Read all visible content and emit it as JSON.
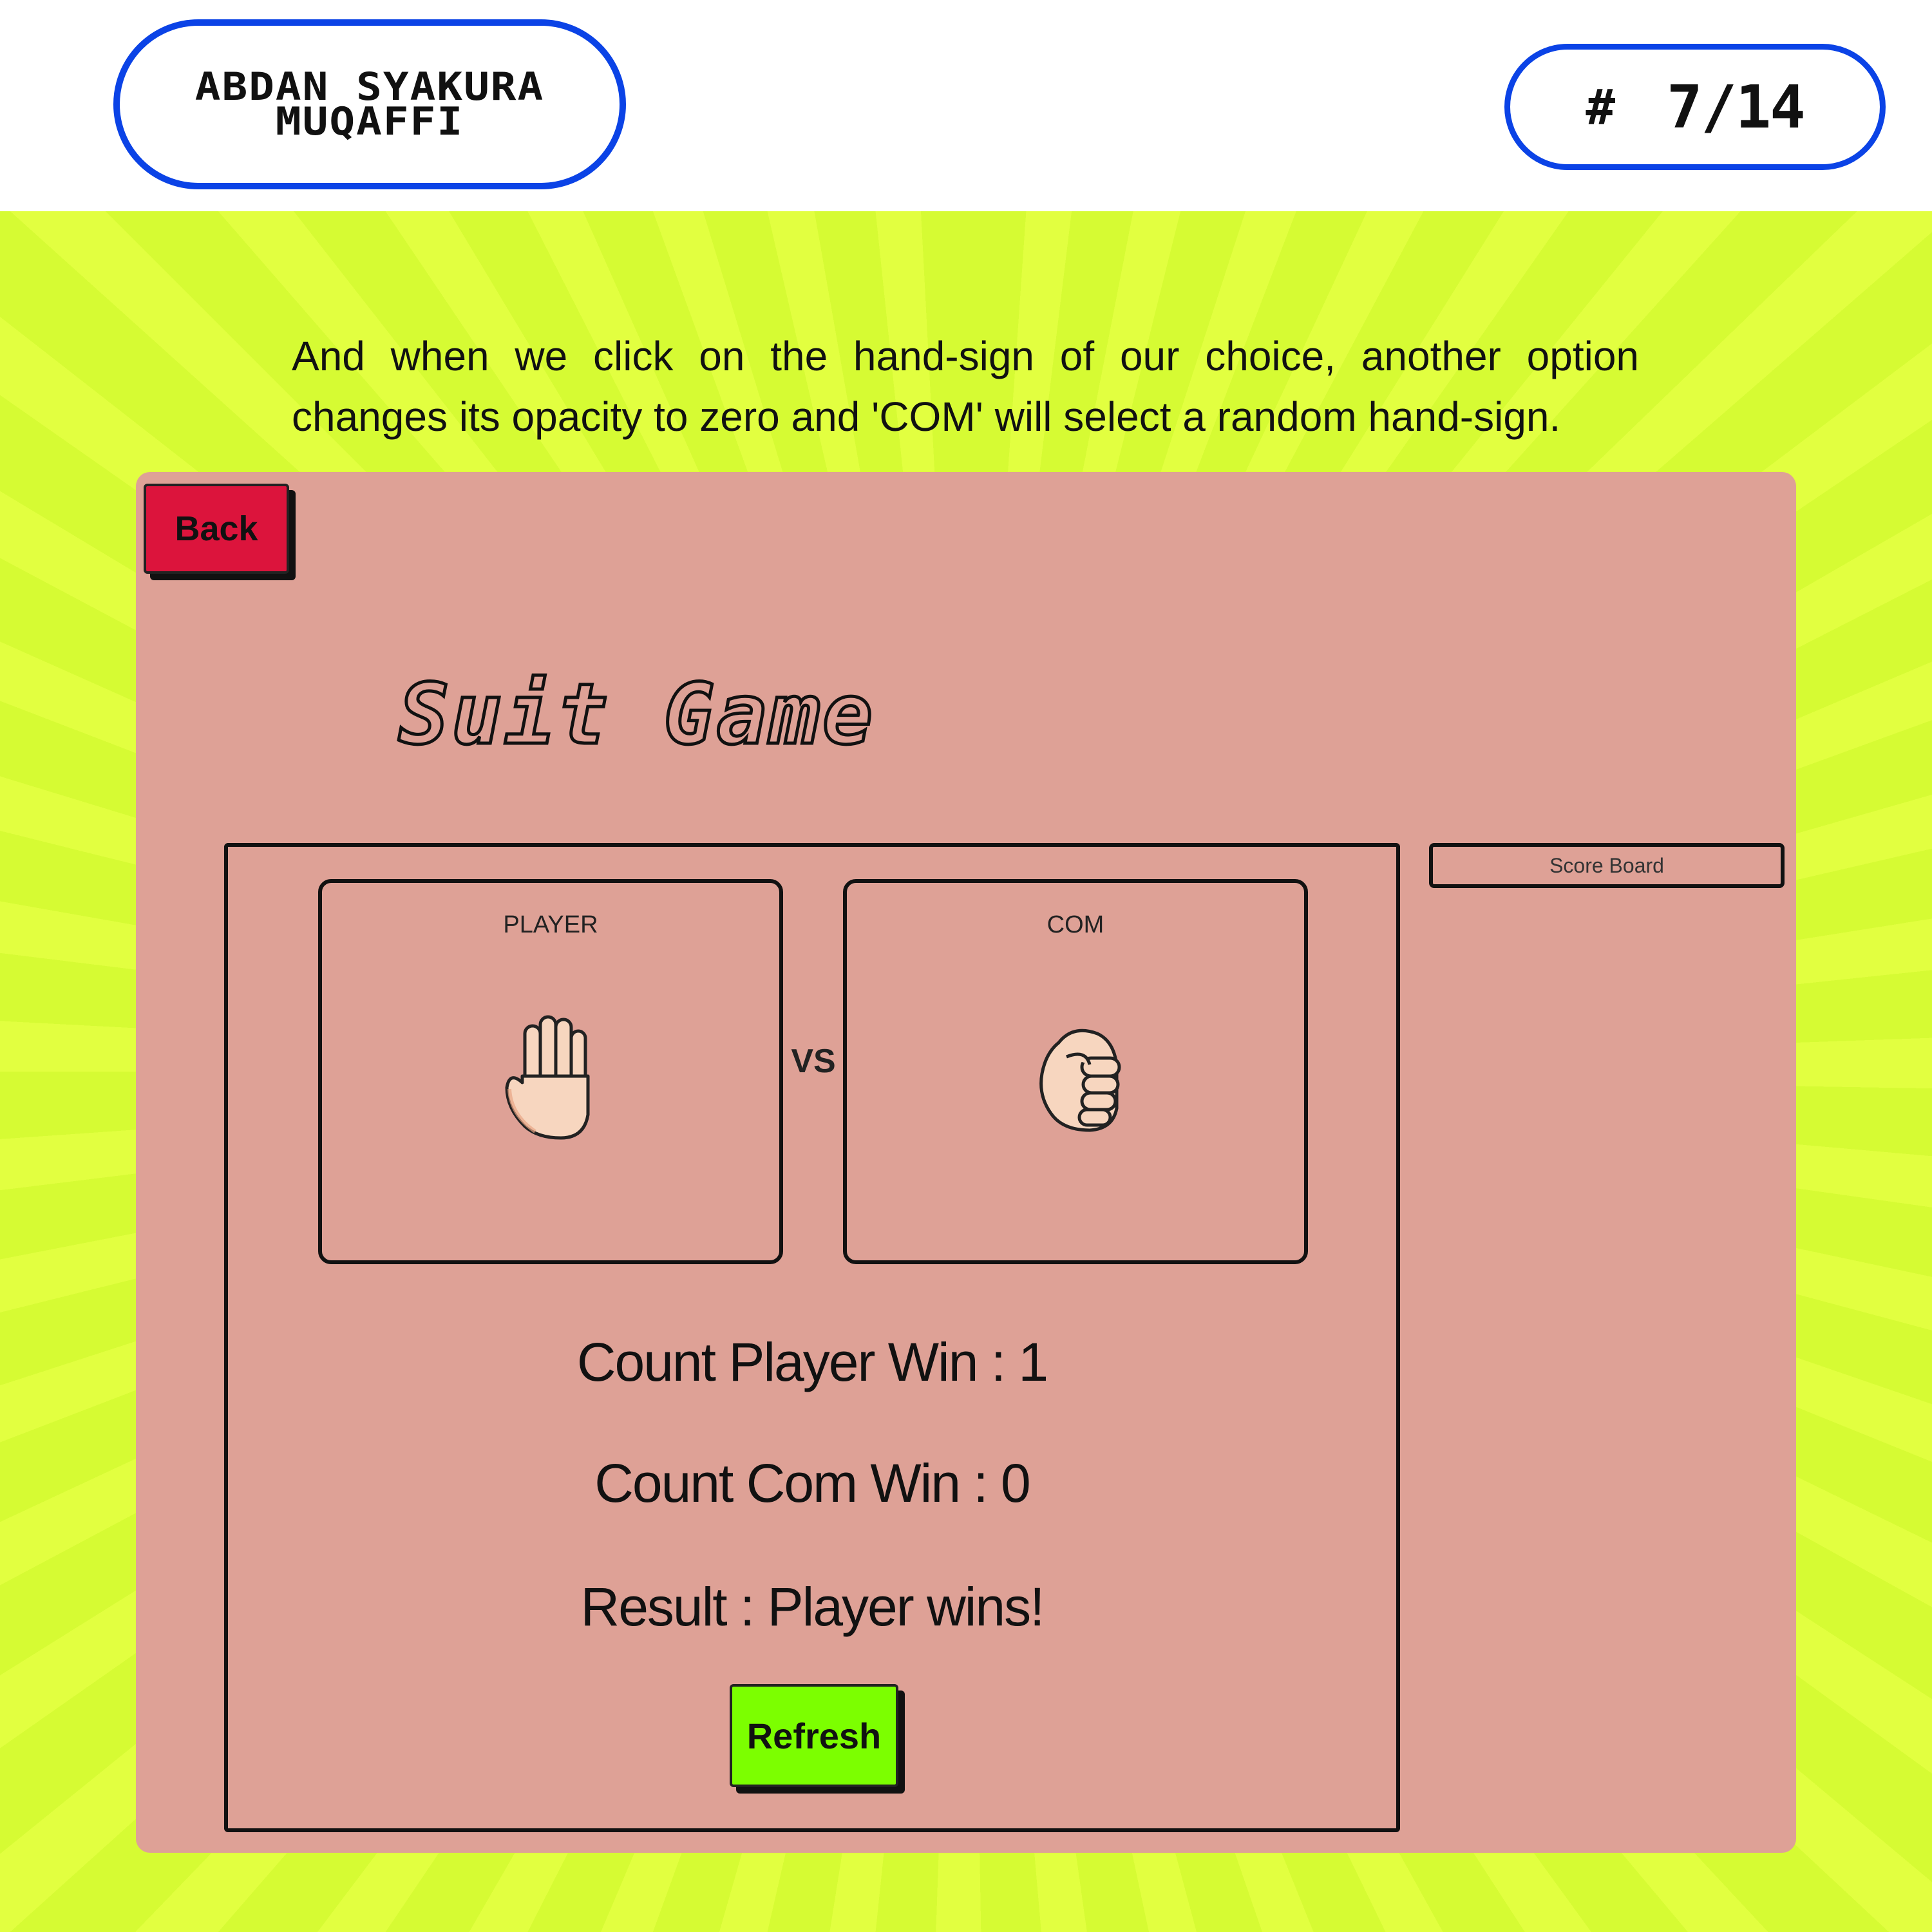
{
  "header": {
    "author_name": "ABDAN SYAKURA MUQAFFI",
    "page_hash": "#",
    "page_number": "7/14"
  },
  "caption": "And when we click on the hand-sign of our choice, another option changes its opacity to zero and 'COM' will select a random hand-sign.",
  "game": {
    "back_label": "Back",
    "title": "Suit Game",
    "player_label": "PLAYER",
    "com_label": "COM",
    "vs_label": "VS",
    "player_hand": "paper-hand-icon",
    "com_hand": "rock-hand-icon",
    "count_player_win": "Count Player Win : 1",
    "count_com_win": "Count Com Win : 0",
    "result": "Result : Player wins!",
    "refresh_label": "Refresh",
    "scoreboard_label": "Score Board"
  },
  "colors": {
    "accent_blue": "#0b43e6",
    "background_lime": "#dcfc36",
    "panel": "#dea196",
    "back_button": "#dc143c",
    "refresh_button": "#7cff00"
  }
}
